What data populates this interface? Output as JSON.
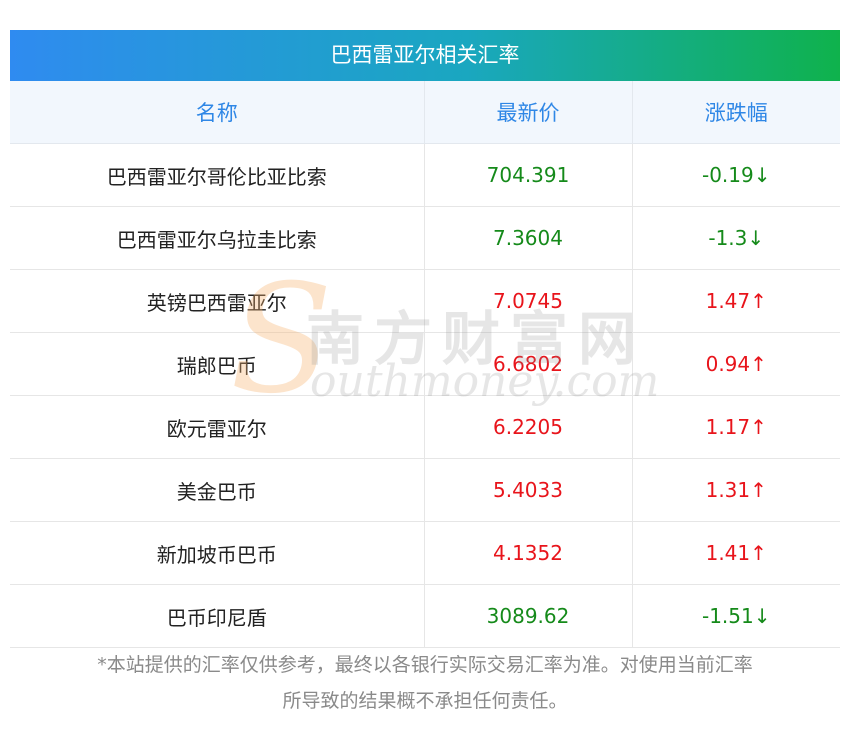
{
  "title": "巴西雷亚尔相关汇率",
  "headers": [
    "名称",
    "最新价",
    "涨跌幅"
  ],
  "rows": [
    {
      "name": "巴西雷亚尔哥伦比亚比索",
      "price": "704.391",
      "change": "-0.19↓",
      "trend": "down"
    },
    {
      "name": "巴西雷亚尔乌拉圭比索",
      "price": "7.3604",
      "change": "-1.3↓",
      "trend": "down"
    },
    {
      "name": "英镑巴西雷亚尔",
      "price": "7.0745",
      "change": "1.47↑",
      "trend": "up"
    },
    {
      "name": "瑞郎巴币",
      "price": "6.6802",
      "change": "0.94↑",
      "trend": "up"
    },
    {
      "name": "欧元雷亚尔",
      "price": "6.2205",
      "change": "1.17↑",
      "trend": "up"
    },
    {
      "name": "美金巴币",
      "price": "5.4033",
      "change": "1.31↑",
      "trend": "up"
    },
    {
      "name": "新加坡币巴币",
      "price": "4.1352",
      "change": "1.41↑",
      "trend": "up"
    },
    {
      "name": "巴币印尼盾",
      "price": "3089.62",
      "change": "-1.51↓",
      "trend": "down"
    }
  ],
  "watermark": {
    "letter": "S",
    "chinese": "南方财富网",
    "english": "outhmoney.com"
  },
  "footnote": {
    "line1": "*本站提供的汇率仅供参考，最终以各银行实际交易汇率为准。对使用当前汇率",
    "line2": "所导致的结果概不承担任何责任。"
  },
  "colors": {
    "up": "#e8141b",
    "down": "#158a1a",
    "header_text": "#2f87e6"
  }
}
